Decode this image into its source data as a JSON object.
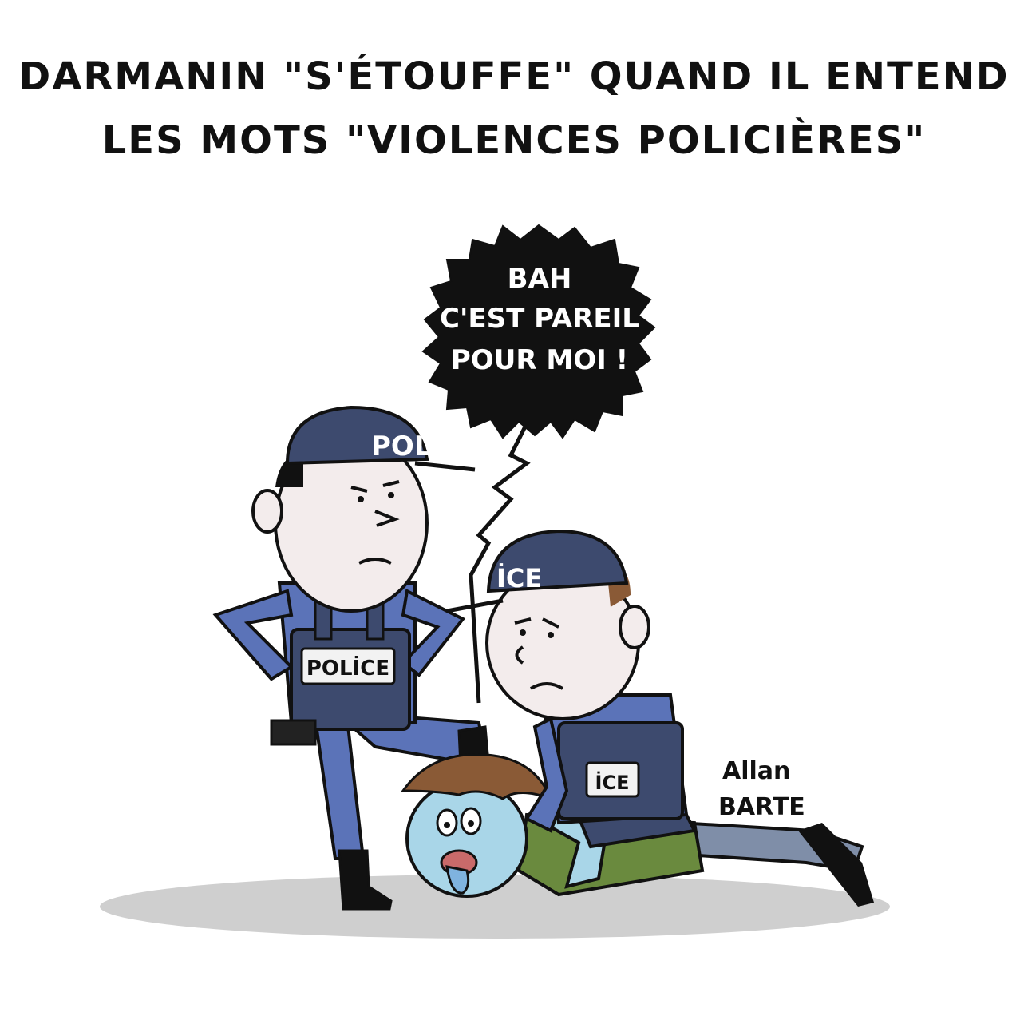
{
  "caption": {
    "line1": "DARMANIN \"S'ÉTOUFFE\" QUAND IL ENTEND",
    "line2": "LES MOTS \"VIOLENCES POLICIÈRES\""
  },
  "speech_bubble": {
    "line1": "BAH",
    "line2": "C'EST PAREIL",
    "line3": "POUR MOI !"
  },
  "officer_standing": {
    "cap_text": "POL",
    "vest_label": "POLİCE"
  },
  "officer_kneeling": {
    "cap_text": "İCE",
    "vest_label": "İCE"
  },
  "signature": {
    "line1": "Allan",
    "line2": "BARTE"
  },
  "colors": {
    "uniform_blue": "#5b73b8",
    "vest_navy": "#3d4a6e",
    "skin": "#f3ecec",
    "victim_skin": "#a9d6e8",
    "victim_shirt": "#6a8a3e",
    "hair_brown": "#8a5a36",
    "shadow": "#cfcfcf",
    "bubble": "#111111"
  }
}
